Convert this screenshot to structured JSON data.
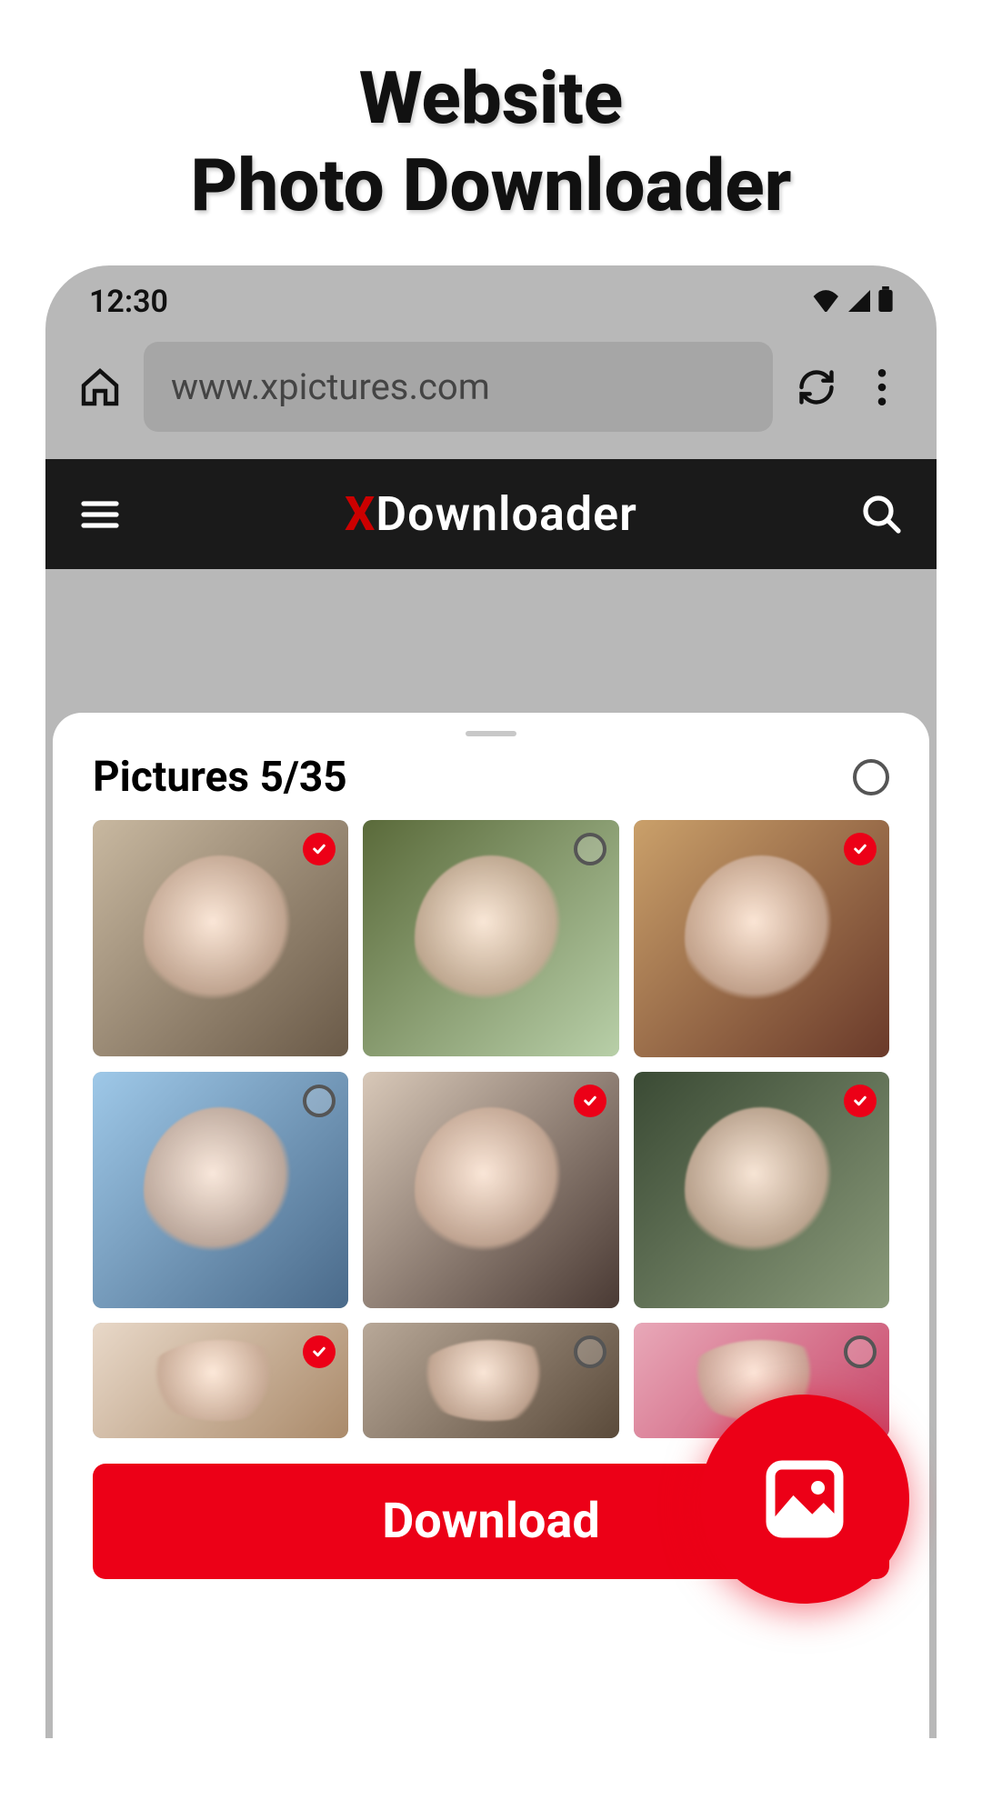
{
  "promo": {
    "line1": "Website",
    "line2": "Photo Downloader"
  },
  "statusbar": {
    "time": "12:30"
  },
  "browser": {
    "url": "www.xpictures.com"
  },
  "app": {
    "title_prefix": "X",
    "title_rest": "Downloader"
  },
  "sheet": {
    "title": "Pictures 5/35",
    "download_label": "Download",
    "select_all_checked": false
  },
  "thumbs": [
    {
      "selected": true,
      "c1": "#c8b8a0",
      "c2": "#6a5a48"
    },
    {
      "selected": false,
      "c1": "#5a6a3a",
      "c2": "#b8cfa8"
    },
    {
      "selected": true,
      "c1": "#caa06a",
      "c2": "#6a3a2a"
    },
    {
      "selected": false,
      "c1": "#9ec8e8",
      "c2": "#4a6a8a"
    },
    {
      "selected": true,
      "c1": "#d8c8b8",
      "c2": "#4a3a34"
    },
    {
      "selected": true,
      "c1": "#3a4a34",
      "c2": "#8a9a7a"
    },
    {
      "selected": true,
      "c1": "#e8d8c8",
      "c2": "#aa8a6a"
    },
    {
      "selected": false,
      "c1": "#b8a898",
      "c2": "#5a4a3a"
    },
    {
      "selected": false,
      "c1": "#e8a8b8",
      "c2": "#c8486a"
    }
  ]
}
